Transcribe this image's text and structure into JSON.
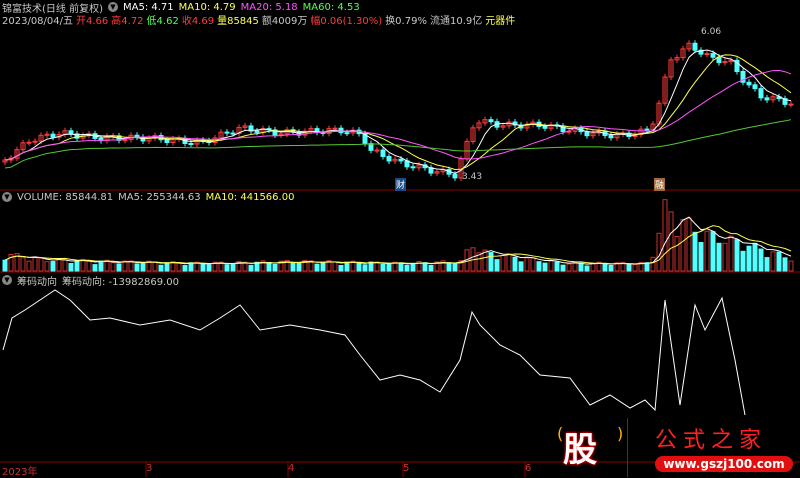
{
  "header": {
    "title": "锦富技术(日线 前复权)",
    "ma5": "MA5: 4.71",
    "ma10": "MA10: 4.79",
    "ma20": "MA20: 5.18",
    "ma60": "MA60: 4.53",
    "date": "2023/08/04/五",
    "open_l": "开",
    "open": "4.66",
    "high_l": "高",
    "high": "4.72",
    "low_l": "低",
    "low": "4.62",
    "close_l": "收",
    "close": "4.69",
    "vol_l": "量",
    "vol": "85845",
    "amt": "额4009万",
    "chg_l": "幅",
    "chg": "0.06(1.30%)",
    "turn": "换0.79%",
    "float": "流通10.9亿",
    "sector": "元器件"
  },
  "price": {
    "max_label": "6.06",
    "min_label": "3.43",
    "tag_cai": "财",
    "tag_rong": "融"
  },
  "volume": {
    "label": "VOLUME: 85844.81",
    "ma5": "MA5: 255344.63",
    "ma10": "MA10: 441566.00"
  },
  "indicator": {
    "name": "筹码动向",
    "label": "筹码动向: -13982869.00"
  },
  "axis": [
    "2023年",
    "3",
    "4",
    "5",
    "6"
  ],
  "logo": {
    "char": "股",
    "name": "公式之家",
    "url": "www.gszj100.com"
  },
  "colors": {
    "up": "#ff3c3c",
    "down": "#54ffff",
    "ma5": "#ffffff",
    "ma10": "#ffff54",
    "ma20": "#ff54ff",
    "ma60": "#54c832"
  }
}
